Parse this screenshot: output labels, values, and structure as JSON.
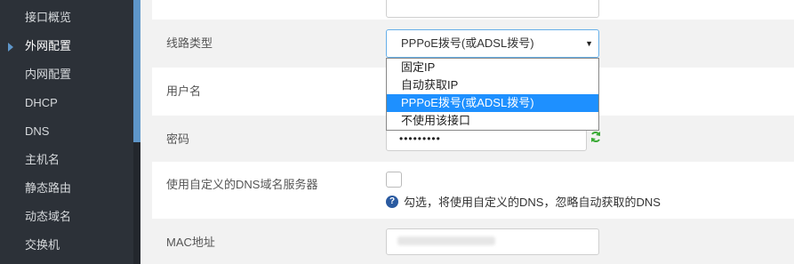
{
  "sidebar": {
    "items": [
      {
        "label": "接口概览"
      },
      {
        "label": "外网配置"
      },
      {
        "label": "内网配置"
      },
      {
        "label": "DHCP"
      },
      {
        "label": "DNS"
      },
      {
        "label": "主机名"
      },
      {
        "label": "静态路由"
      },
      {
        "label": "动态域名"
      },
      {
        "label": "交换机"
      }
    ],
    "active_item": "外网配置"
  },
  "form": {
    "line_type": {
      "label": "线路类型",
      "value": "PPPoE拨号(或ADSL拨号)",
      "arrow": "▼",
      "options": [
        {
          "label": "固定IP"
        },
        {
          "label": "自动获取IP"
        },
        {
          "label": "PPPoE拨号(或ADSL拨号)"
        },
        {
          "label": "不使用该接口"
        }
      ]
    },
    "username": {
      "label": "用户名"
    },
    "password": {
      "label": "密码",
      "value": "•••••••••",
      "refresh_icon": "refresh-icon"
    },
    "custom_dns": {
      "label": "使用自定义的DNS域名服务器",
      "checked": false,
      "hint": "勾选，将使用自定义的DNS，忽略自动获取的DNS",
      "hint_icon": "?"
    },
    "mac": {
      "label": "MAC地址"
    }
  },
  "colors": {
    "sidebar_bg": "#2c3138",
    "accent": "#5e96c9",
    "selected_option": "#1e90ff",
    "help_icon": "#2a5aa0",
    "refresh_icon": "#3aaa35"
  }
}
